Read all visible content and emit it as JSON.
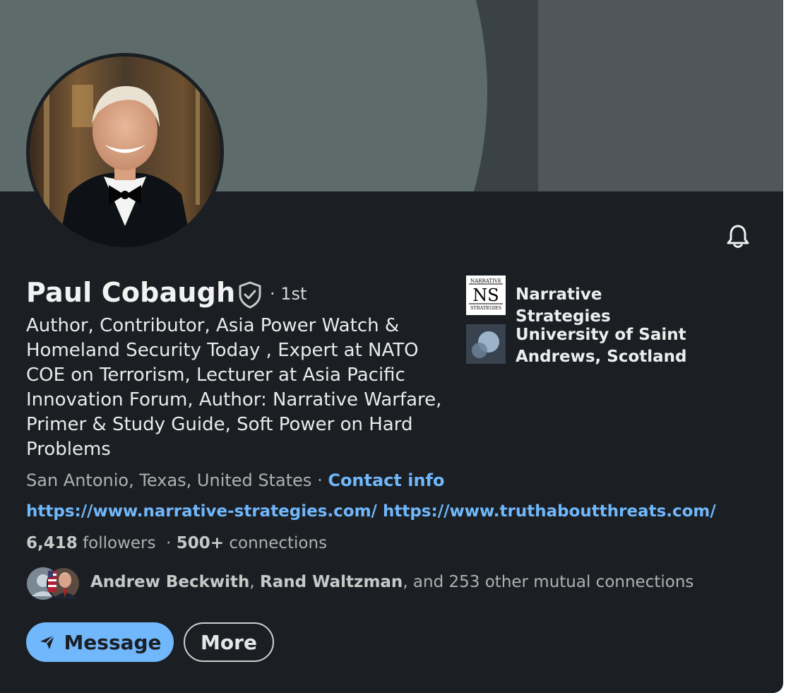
{
  "profile": {
    "name": "Paul Cobaugh",
    "degree": "· 1st",
    "headline": "Author, Contributor, Asia Power Watch & Homeland Security Today , Expert at NATO COE on Terrorism, Lecturer at Asia Pacific Innovation Forum, Author: Narrative Warfare, Primer & Study Guide, Soft Power on Hard Problems",
    "location": "San Antonio, Texas, United States",
    "location_sep": " · ",
    "contact_label": "Contact info",
    "website_1": "https://www.narrative-strategies.com/",
    "website_2": "https://www.truthaboutthreats.com/",
    "followers_count": "6,418",
    "followers_label": "followers",
    "stats_sep": "·",
    "connections_count": "500+",
    "connections_label": "connections"
  },
  "mutual": {
    "name_1": "Andrew Beckwith",
    "sep": ", ",
    "name_2": "Rand Waltzman",
    "rest": ", and 253 other mutual connections"
  },
  "actions": {
    "message_label": "Message",
    "more_label": "More"
  },
  "orgs": [
    {
      "name": "Narrative Strategies",
      "logo_top": "NARRATIVE",
      "logo_mid": "NS",
      "logo_bottom": "STRATEGIES"
    },
    {
      "name": "University of Saint Andrews, Scotland"
    }
  ],
  "icons": {
    "bell": "bell-icon",
    "verified": "verified-shield-icon",
    "send": "send-icon"
  },
  "colors": {
    "background": "#1b1f23",
    "link": "#71b7fb",
    "primary_button": "#71b7fb"
  }
}
